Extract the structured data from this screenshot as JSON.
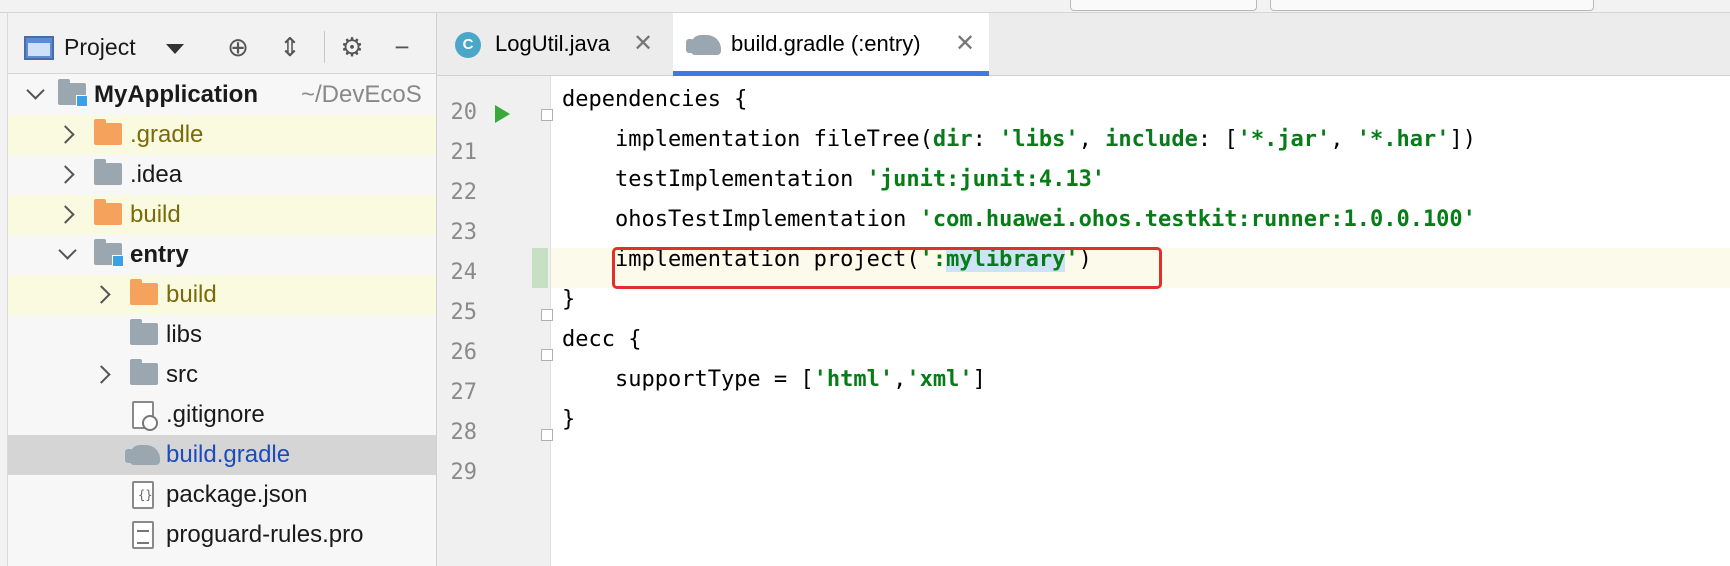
{
  "colors": {
    "tab_underline": "#3d7be0",
    "string_green": "#067d17",
    "highlight_red": "#e0302c",
    "run_green": "#3aa83a",
    "folder_orange": "#f5a35c"
  },
  "project_panel": {
    "title": "Project",
    "toolbar_icons": [
      "locate-icon",
      "collapse-icon",
      "gear-icon",
      "minimize-icon"
    ],
    "tree": [
      {
        "label": "MyApplication",
        "hint": "~/DevEcoS",
        "arrow": "down",
        "icon": "module-folder-icon"
      },
      {
        "label": ".gradle",
        "arrow": "right",
        "icon": "folder-orange-icon"
      },
      {
        "label": ".idea",
        "arrow": "right",
        "icon": "folder-gray-icon"
      },
      {
        "label": "build",
        "arrow": "right",
        "icon": "folder-orange-icon"
      },
      {
        "label": "entry",
        "arrow": "down",
        "icon": "module-folder-icon"
      },
      {
        "label": "build",
        "arrow": "right",
        "icon": "folder-orange-icon"
      },
      {
        "label": "libs",
        "icon": "folder-gray-icon"
      },
      {
        "label": "src",
        "arrow": "right",
        "icon": "folder-gray-icon"
      },
      {
        "label": ".gitignore",
        "icon": "gitignore-file-icon"
      },
      {
        "label": "build.gradle",
        "icon": "gradle-icon",
        "selected": true
      },
      {
        "label": "package.json",
        "icon": "json-file-icon"
      },
      {
        "label": "proguard-rules.pro",
        "icon": "text-file-icon"
      }
    ]
  },
  "editor": {
    "tabs": [
      {
        "label": "LogUtil.java",
        "icon": "java-class-icon",
        "active": false
      },
      {
        "label": "build.gradle (:entry)",
        "icon": "gradle-icon",
        "active": true
      }
    ],
    "lines": [
      {
        "num": "20",
        "text": "dependencies {"
      },
      {
        "num": "21",
        "text": "    implementation fileTree(dir: 'libs', include: ['*.jar', '*.har'])"
      },
      {
        "num": "22",
        "text": "    testImplementation 'junit:junit:4.13'"
      },
      {
        "num": "23",
        "text": "    ohosTestImplementation 'com.huawei.ohos.testkit:runner:1.0.0.100'"
      },
      {
        "num": "24",
        "text": "    implementation project(':mylibrary')"
      },
      {
        "num": "25",
        "text": "}"
      },
      {
        "num": "26",
        "text": "decc {"
      },
      {
        "num": "27",
        "text": "    supportType = ['html','xml']"
      },
      {
        "num": "28",
        "text": "}"
      },
      {
        "num": "29",
        "text": ""
      }
    ]
  }
}
